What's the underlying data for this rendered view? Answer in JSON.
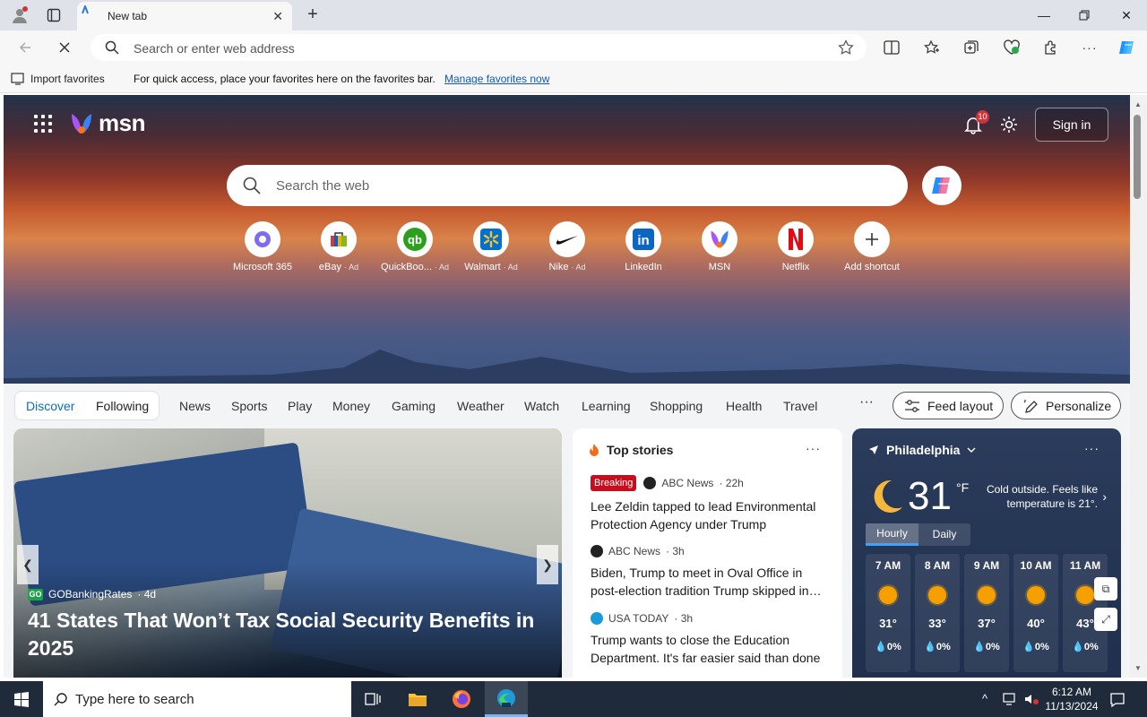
{
  "browser": {
    "tab_title": "New tab",
    "address_placeholder": "Search or enter web address"
  },
  "favbar": {
    "import_label": "Import favorites",
    "message": "For quick access, place your favorites here on the favorites bar.",
    "manage_link": "Manage favorites now"
  },
  "msn": {
    "logo_text": "msn",
    "notification_count": "10",
    "sign_in": "Sign in",
    "search_placeholder": "Search the web"
  },
  "shortcuts": [
    {
      "label": "Microsoft 365",
      "ad": "",
      "icon": "microsoft-365-icon"
    },
    {
      "label": "eBay",
      "ad": "· Ad",
      "icon": "ebay-icon"
    },
    {
      "label": "QuickBoo...",
      "ad": "· Ad",
      "icon": "quickbooks-icon"
    },
    {
      "label": "Walmart",
      "ad": "· Ad",
      "icon": "walmart-icon"
    },
    {
      "label": "Nike",
      "ad": "· Ad",
      "icon": "nike-icon"
    },
    {
      "label": "LinkedIn",
      "ad": "",
      "icon": "linkedin-icon"
    },
    {
      "label": "MSN",
      "ad": "",
      "icon": "msn-icon"
    },
    {
      "label": "Netflix",
      "ad": "",
      "icon": "netflix-icon"
    },
    {
      "label": "Add shortcut",
      "ad": "",
      "icon": "plus-icon"
    }
  ],
  "nav": {
    "discover": "Discover",
    "following": "Following",
    "items": [
      "News",
      "Sports",
      "Play",
      "Money",
      "Gaming",
      "Weather",
      "Watch",
      "Learning",
      "Shopping",
      "Health",
      "Travel"
    ],
    "more": "···",
    "feed_layout": "Feed layout",
    "personalize": "Personalize"
  },
  "hero": {
    "source": "GOBankingRates",
    "age": "· 4d",
    "source_badge": "GO",
    "title": "41 States That Won’t Tax Social Security Benefits in 2025"
  },
  "top_stories": {
    "heading": "Top stories",
    "more": "···",
    "items": [
      {
        "badge": "Breaking",
        "source": "ABC News",
        "age": "· 22h",
        "headline": "Lee Zeldin tapped to lead Environmental Protection Agency under Trump"
      },
      {
        "badge": "",
        "source": "ABC News",
        "age": "· 3h",
        "headline": "Biden, Trump to meet in Oval Office in post-election tradition Trump skipped in 2020"
      },
      {
        "badge": "",
        "source": "USA TODAY",
        "age": "· 3h",
        "headline": "Trump wants to close the Education Department. It's far easier said than done"
      }
    ]
  },
  "weather": {
    "city": "Philadelphia",
    "temp": "31",
    "unit": "°F",
    "condition": "Cold outside. Feels like temperature is 21°.",
    "tab_hourly": "Hourly",
    "tab_daily": "Daily",
    "more": "···",
    "hours": [
      {
        "time": "7 AM",
        "temp": "31°",
        "precip": "0%"
      },
      {
        "time": "8 AM",
        "temp": "33°",
        "precip": "0%"
      },
      {
        "time": "9 AM",
        "temp": "37°",
        "precip": "0%"
      },
      {
        "time": "10 AM",
        "temp": "40°",
        "precip": "0%"
      },
      {
        "time": "11 AM",
        "temp": "43°",
        "precip": "0%"
      }
    ]
  },
  "taskbar": {
    "search_placeholder": "Type here to search",
    "time": "6:12 AM",
    "date": "11/13/2024"
  },
  "colors": {
    "accent": "#0f6cbd",
    "breaking": "#c50f1f",
    "taskbar": "#1f2b3a"
  }
}
